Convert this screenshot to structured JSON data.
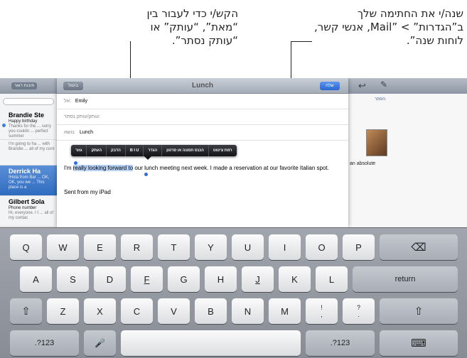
{
  "callouts": {
    "left_text": "הקש/י כדי לעבור בין “מאת”, “עותק” או “עותק נסתר”.",
    "right_text": "שנה/י את החתימה שלך ב”הגדרות” > ”Mail, אנשי קשר, לוחות שנה”."
  },
  "background_mail": {
    "items": [
      {
        "sender": "Brandie Ste",
        "subject": "Happy birthday",
        "preview": "Thanks for the ... sorry you couldn ... perfect summer"
      },
      {
        "sender": "",
        "subject": "",
        "preview": "I'm going to ha ... with Brandie ... all of my cont"
      },
      {
        "sender": "Derrick Ha",
        "subject": "",
        "preview": "!Hola from Bar ... OK, OK, you we ... This place is a"
      },
      {
        "sender": "Gilbert Sola",
        "subject": "Phone number",
        "preview": "Hi, everyone. I t ... all of my contac"
      }
    ],
    "hide_label": "הסתר",
    "right_fragment": "an absolute"
  },
  "compose": {
    "title": "Lunch",
    "cancel_label": "ביטול",
    "send_label": "שלח",
    "to_label": "אל:",
    "to_value": "Emily",
    "cc_bcc_label": "עותק/עותק נסתר:",
    "subject_label": "נושא:",
    "subject_value": "Lunch",
    "body_before": "I'm ",
    "body_selected": "really looking forward to",
    "body_after": " our lunch meeting next week. I made a reservation at our favorite Italian spot.",
    "signature": "Sent from my iPad"
  },
  "context_menu": {
    "items": [
      "גזור",
      "העתק",
      "הדבק",
      "B I U",
      "הגדר",
      "הכנס תמונה או סרטון",
      "רמת ציטוט"
    ]
  },
  "keyboard": {
    "row1": [
      "Q",
      "W",
      "E",
      "R",
      "T",
      "Y",
      "U",
      "I",
      "O",
      "P"
    ],
    "row2": [
      "A",
      "S",
      "D",
      "F",
      "G",
      "H",
      "J",
      "K",
      "L"
    ],
    "row3": [
      "Z",
      "X",
      "C",
      "V",
      "B",
      "N",
      "M"
    ],
    "backspace_glyph": "⌫",
    "return_label": "return",
    "shift_glyph": "⇧",
    "excl_top": "!",
    "excl_bottom": ",",
    "q_top": "?",
    "q_bottom": ".",
    "numbers_label": ".?123",
    "mic_glyph": "🎤",
    "hide_glyph": "⌨"
  }
}
